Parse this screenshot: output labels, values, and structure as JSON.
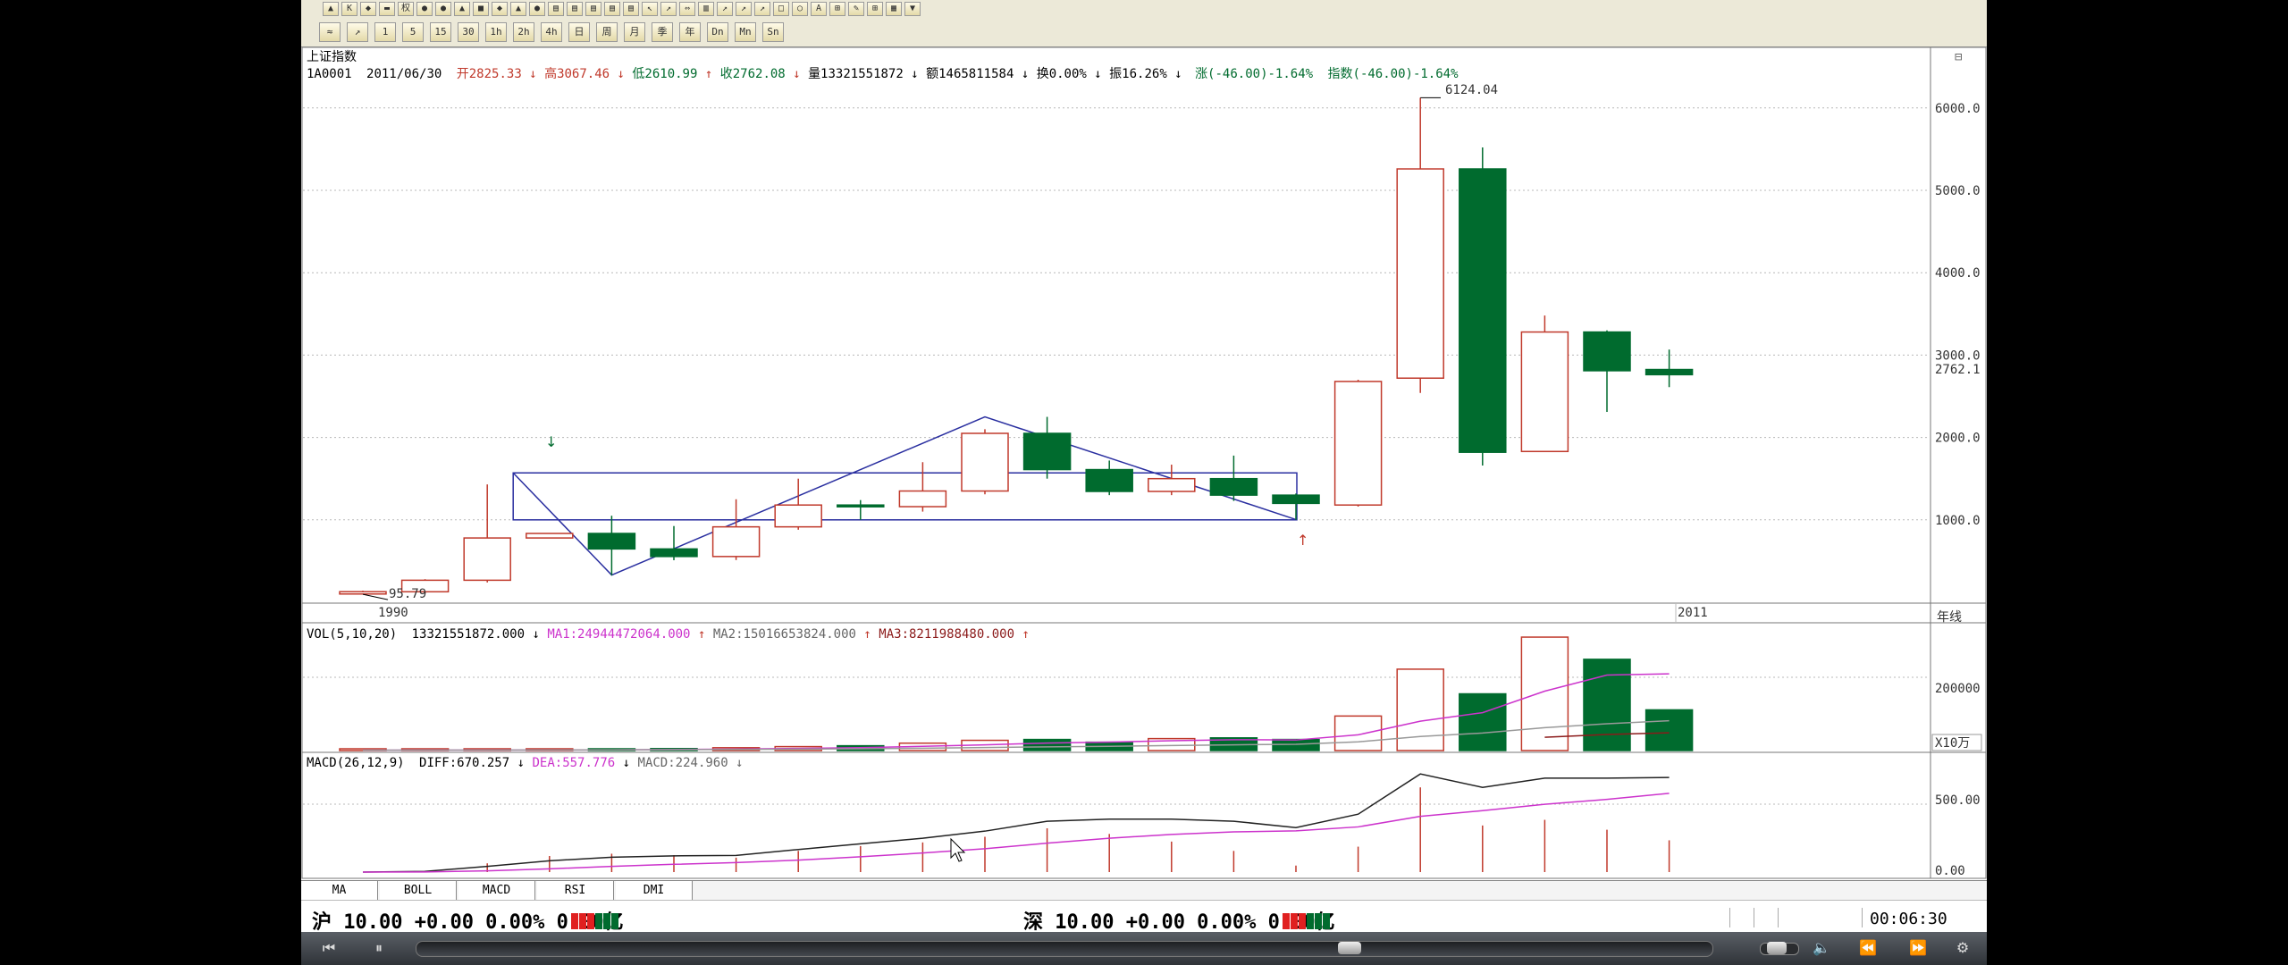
{
  "toolbar": {
    "top_glyphs": [
      "▲",
      "K",
      "◆",
      "▬",
      "权",
      "●",
      "●",
      "▲",
      "■",
      "◆",
      "▲",
      "●",
      "▤",
      "▤",
      "▤",
      "▤",
      "▤",
      "↖",
      "↗",
      "⇔",
      "▥",
      "↗",
      "↗",
      "↗",
      "□",
      "○",
      "A",
      "⊞",
      "✎",
      "⊞",
      "▦",
      "▼"
    ],
    "period_buttons": [
      "≈",
      "↗",
      "1",
      "5",
      "15",
      "30",
      "1h",
      "2h",
      "4h",
      "日",
      "周",
      "月",
      "季",
      "年",
      "Dn",
      "Mn",
      "Sn"
    ]
  },
  "header": {
    "title": "上证指数",
    "code": "1A0001",
    "date": "2011/06/30",
    "open": "开2825.33",
    "high": "高3067.46",
    "low": "低2610.99",
    "close": "收2762.08",
    "volume": "量13321551872",
    "amount": "额1465811584",
    "turnover": "换0.00%",
    "amplitude": "振16.26%",
    "change": "涨(-46.00)-1.64%",
    "index_change": "指数(-46.00)-1.64%"
  },
  "price_axis": {
    "ticks": [
      "6000.0",
      "5000.0",
      "4000.0",
      "3000.0",
      "2000.0",
      "1000.0"
    ],
    "current_price": "2762.1",
    "period_label": "年线"
  },
  "annotations": {
    "max_label": "6124.04",
    "min_label": "95.79",
    "year_start": "1990",
    "year_end": "2011"
  },
  "candles": [
    {
      "o": 100,
      "c": 128,
      "h": 140,
      "l": 96
    },
    {
      "o": 127,
      "c": 267,
      "h": 280,
      "l": 105
    },
    {
      "o": 267,
      "c": 780,
      "h": 1430,
      "l": 240
    },
    {
      "o": 780,
      "c": 835,
      "h": 840,
      "l": 780
    },
    {
      "o": 835,
      "c": 647,
      "h": 1050,
      "l": 325
    },
    {
      "o": 647,
      "c": 555,
      "h": 925,
      "l": 510
    },
    {
      "o": 555,
      "c": 915,
      "h": 1250,
      "l": 512
    },
    {
      "o": 915,
      "c": 1180,
      "h": 1500,
      "l": 880
    },
    {
      "o": 1180,
      "c": 1160,
      "h": 1240,
      "l": 1000
    },
    {
      "o": 1160,
      "c": 1350,
      "h": 1700,
      "l": 1100
    },
    {
      "o": 1350,
      "c": 2050,
      "h": 2100,
      "l": 1310
    },
    {
      "o": 2050,
      "c": 1610,
      "h": 2250,
      "l": 1500
    },
    {
      "o": 1610,
      "c": 1345,
      "h": 1720,
      "l": 1300
    },
    {
      "o": 1345,
      "c": 1500,
      "h": 1670,
      "l": 1300
    },
    {
      "o": 1500,
      "c": 1300,
      "h": 1780,
      "l": 1230
    },
    {
      "o": 1300,
      "c": 1200,
      "h": 1320,
      "l": 1000
    },
    {
      "o": 1180,
      "c": 2680,
      "h": 2700,
      "l": 1160
    },
    {
      "o": 2720,
      "c": 5260,
      "h": 6124,
      "l": 2540
    },
    {
      "o": 5260,
      "c": 1820,
      "h": 5520,
      "l": 1660
    },
    {
      "o": 1830,
      "c": 3280,
      "h": 3480,
      "l": 1830
    },
    {
      "o": 3280,
      "c": 2810,
      "h": 3300,
      "l": 2310
    },
    {
      "o": 2825,
      "c": 2762,
      "h": 3067,
      "l": 2611
    }
  ],
  "volume_panel": {
    "label": "VOL(5,10,20)",
    "value": "13321551872.000",
    "ma1": "MA1:24944472064.000",
    "ma2": "MA2:15016653824.000",
    "ma3": "MA3:8211988480.000",
    "axis_tick": "200000",
    "unit": "X10万",
    "volumes": [
      0.3,
      0.4,
      0.5,
      0.6,
      1.0,
      1.6,
      2.3,
      3.2,
      3.9,
      6.0,
      8.3,
      9.0,
      6.8,
      9.7,
      10.3,
      9.0,
      28.0,
      66.0,
      46.0,
      92.0,
      74.0,
      33.0
    ],
    "ma1_values": [
      0.3,
      0.35,
      0.4,
      0.45,
      0.56,
      0.82,
      1.2,
      1.74,
      2.4,
      3.4,
      4.66,
      6.08,
      6.84,
      7.96,
      8.82,
      8.56,
      12.76,
      23.8,
      30.72,
      48.2,
      61.2,
      62.2
    ],
    "ma2_values": [
      0.3,
      0.35,
      0.4,
      0.45,
      0.56,
      0.73,
      0.93,
      1.19,
      1.48,
      1.93,
      2.45,
      3.02,
      3.46,
      4.08,
      4.65,
      5.1,
      7.08,
      11.4,
      14.2,
      18.6,
      21.7,
      24.2
    ],
    "ma3_values": [
      null,
      null,
      null,
      null,
      null,
      null,
      null,
      null,
      null,
      null,
      null,
      null,
      null,
      null,
      null,
      null,
      null,
      null,
      null,
      10.8,
      13.0,
      14.4
    ]
  },
  "macd_panel": {
    "label": "MACD(26,12,9)",
    "diff": "DIFF:670.257",
    "dea": "DEA:557.776",
    "macd": "MACD:224.960",
    "axis_ticks": [
      "500.00",
      "0.00"
    ],
    "diff_values": [
      0,
      5,
      40,
      80,
      105,
      115,
      118,
      160,
      200,
      240,
      290,
      360,
      375,
      375,
      360,
      315,
      410,
      695,
      600,
      665,
      665,
      670
    ],
    "dea_values": [
      0,
      1,
      9,
      23,
      40,
      55,
      67,
      85,
      108,
      135,
      165,
      205,
      240,
      267,
      285,
      292,
      320,
      395,
      435,
      480,
      515,
      558
    ],
    "macd_values": [
      0,
      8,
      62,
      114,
      130,
      120,
      102,
      150,
      184,
      210,
      250,
      310,
      270,
      216,
      150,
      46,
      180,
      600,
      330,
      370,
      300,
      225
    ]
  },
  "tabs": [
    "MA",
    "BOLL",
    "MACD",
    "RSI",
    "DMI"
  ],
  "status": {
    "sh": "沪 10.00 +0.00 0.00% 0.00亿",
    "sz": "深 10.00 +0.00 0.00% 0.00亿",
    "time": "00:06:30"
  },
  "colors": {
    "up": "#c0392b",
    "down": "#006b2e",
    "pattern_line": "#2a2fa0",
    "ma_magenta": "#cc33cc",
    "grid": "#b8b8b8"
  }
}
